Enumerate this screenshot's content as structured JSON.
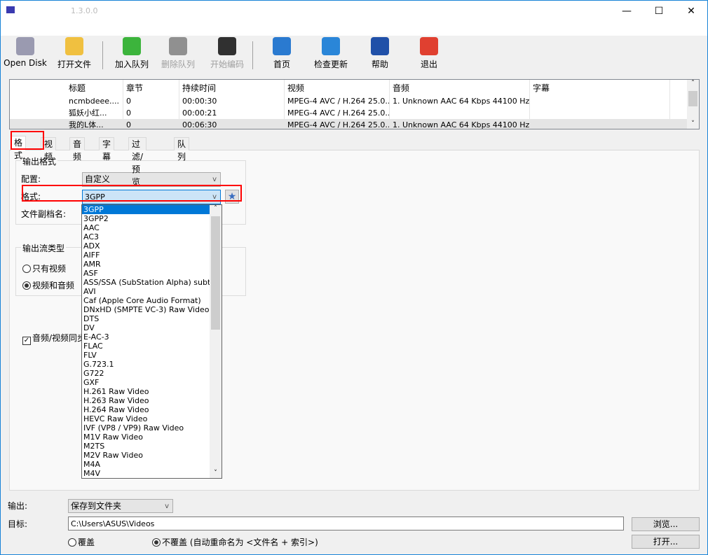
{
  "window": {
    "title_version": "1.3.0.0",
    "minimize": "—",
    "maximize": "☐",
    "close": "✕"
  },
  "toolbar": [
    {
      "label": "Open Disk",
      "icon": "disc-icon",
      "color": "#9a9ab0",
      "disabled": false
    },
    {
      "label": "打开文件",
      "icon": "folder-open-icon",
      "color": "#f0c040",
      "disabled": false
    },
    {
      "label": "加入队列",
      "icon": "add-queue-icon",
      "color": "#3cb43c",
      "disabled": false
    },
    {
      "label": "删除队列",
      "icon": "remove-queue-icon",
      "color": "#909090",
      "disabled": true
    },
    {
      "label": "开始编码",
      "icon": "encode-icon",
      "color": "#303030",
      "disabled": true
    },
    {
      "label": "首页",
      "icon": "globe-icon",
      "color": "#2a7ad0",
      "disabled": false
    },
    {
      "label": "检查更新",
      "icon": "refresh-icon",
      "color": "#2a86d8",
      "disabled": false
    },
    {
      "label": "帮助",
      "icon": "help-icon",
      "color": "#2050a8",
      "disabled": false
    },
    {
      "label": "退出",
      "icon": "power-icon",
      "color": "#e04030",
      "disabled": false
    }
  ],
  "table": {
    "headers": [
      "标题",
      "章节",
      "持续时间",
      "视频",
      "音频",
      "字幕"
    ],
    "rows": [
      [
        "ncmbdeee....",
        "0",
        "00:00:30",
        "MPEG-4 AVC / H.264 25.0...",
        "1. Unknown AAC  64 Kbps 44100 Hz ...",
        ""
      ],
      [
        "狐妖小红...",
        "0",
        "00:00:21",
        "MPEG-4 AVC / H.264 25.0...",
        "",
        ""
      ],
      [
        "我的L体...",
        "0",
        "00:06:30",
        "MPEG-4 AVC / H.264 25.0...",
        "1. Unknown AAC  64 Kbps 44100 Hz ...",
        ""
      ]
    ]
  },
  "tabs": [
    "格式",
    "视频",
    "音频",
    "字幕",
    "过滤/预览",
    "队列"
  ],
  "format": {
    "group_label": "输出格式",
    "profile_label": "配置:",
    "profile_value": "自定义",
    "format_label": "格式:",
    "format_value": "3GPP",
    "ext_label": "文件副档名:",
    "stream_group_label": "输出流类型",
    "radio_video_only": "只有视频",
    "radio_video_audio": "视频和音频",
    "sync_checkbox": "音频/视频同步"
  },
  "dropdown_options": [
    "3GPP",
    "3GPP2",
    "AAC",
    "AC3",
    "ADX",
    "AIFF",
    "AMR",
    "ASF",
    "ASS/SSA (SubStation Alpha) subtitle",
    "AVI",
    "Caf (Apple Core Audio Format)",
    "DNxHD (SMPTE VC-3) Raw Video",
    "DTS",
    "DV",
    "E-AC-3",
    "FLAC",
    "FLV",
    "G.723.1",
    "G722",
    "GXF",
    "H.261 Raw Video",
    "H.263 Raw Video",
    "H.264 Raw Video",
    "HEVC Raw Video",
    "IVF (VP8 / VP9) Raw Video",
    "M1V Raw Video",
    "M2TS",
    "M2V Raw Video",
    "M4A",
    "M4V"
  ],
  "bottom": {
    "output_label": "输出:",
    "output_value": "保存到文件夹",
    "target_label": "目标:",
    "target_value": "C:\\Users\\ASUS\\Videos",
    "browse": "浏览...",
    "open": "打开...",
    "overwrite": "覆盖",
    "no_overwrite": "不覆盖 (自动重命名为 <文件名 + 索引>)"
  }
}
